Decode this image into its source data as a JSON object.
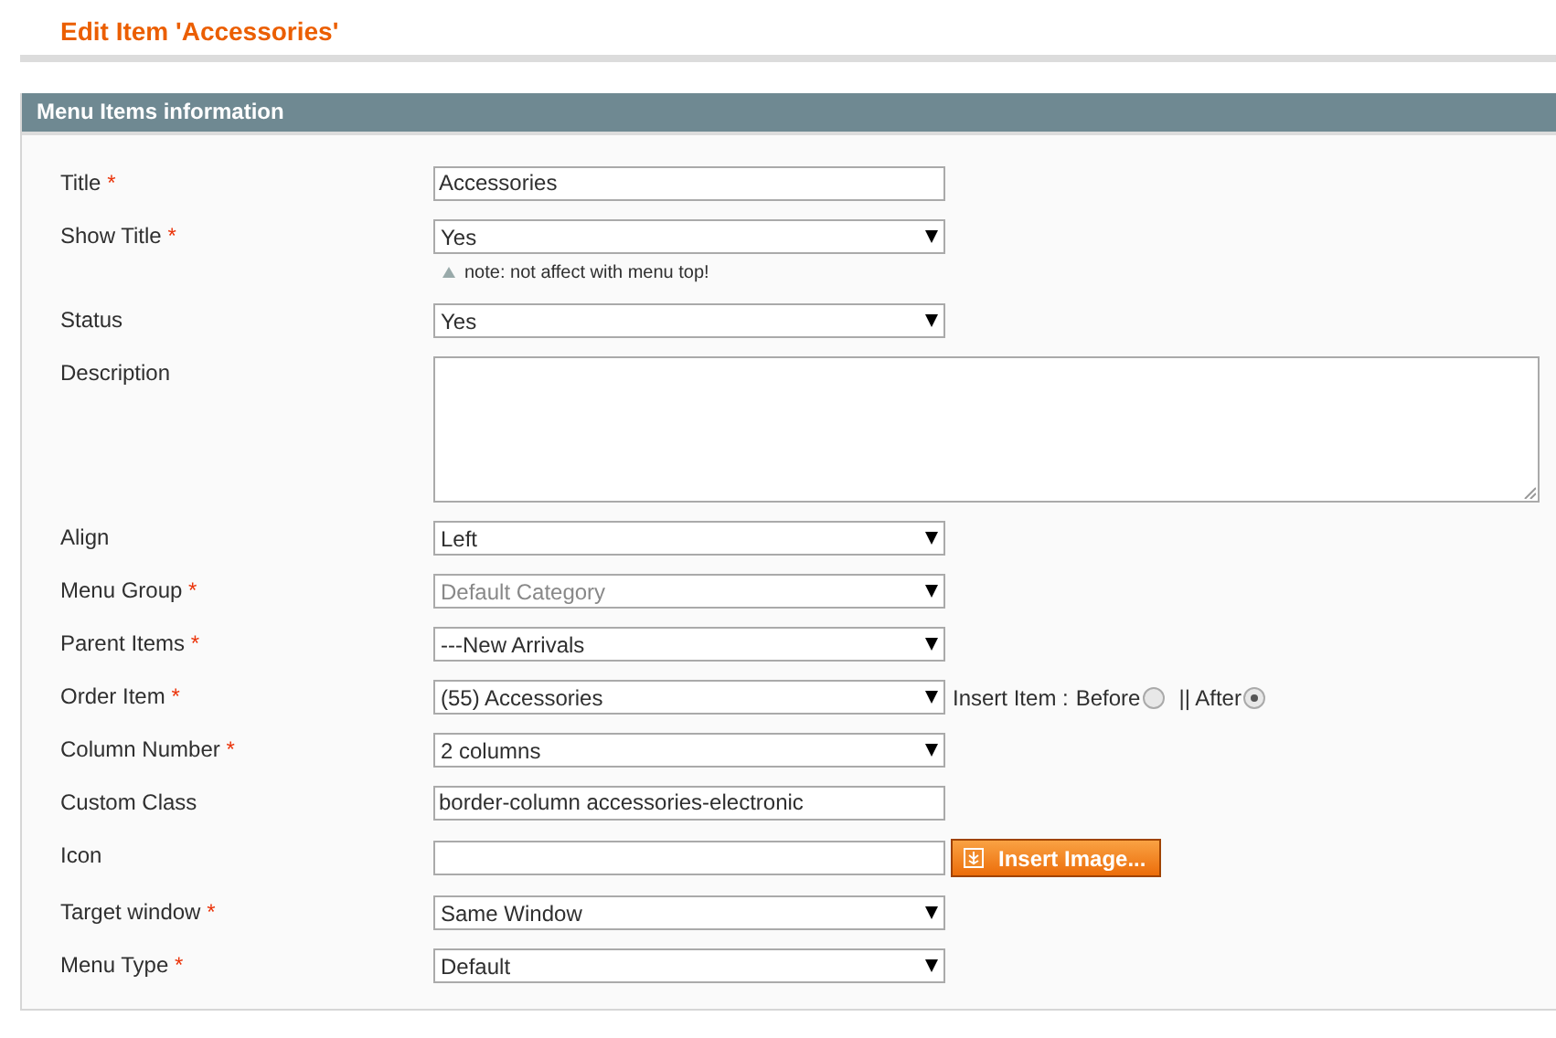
{
  "page_title": "Edit Item 'Accessories'",
  "panel": {
    "title": "Menu Items information",
    "fields": [
      {
        "label": "Title",
        "required_mark": "*",
        "kind": "text",
        "value": "Accessories"
      },
      {
        "label": "Show Title",
        "required_mark": "*",
        "kind": "select",
        "value": "Yes",
        "note": "note: not affect with menu top!"
      },
      {
        "label": "Status",
        "kind": "select",
        "value": "Yes"
      },
      {
        "label": "Description",
        "kind": "textarea"
      },
      {
        "label": "Align",
        "kind": "select",
        "value": "Left"
      },
      {
        "label": "Menu Group",
        "required_mark": "*",
        "kind": "select",
        "value": "Default Category",
        "disabled": true
      },
      {
        "label": "Parent Items",
        "required_mark": "*",
        "kind": "select",
        "value": "---New Arrivals"
      },
      {
        "label": "Order Item",
        "required_mark": "*",
        "kind": "select",
        "value": "(55) Accessories",
        "insert": {
          "label": "Insert Item :",
          "options": [
            {
              "label": "Before",
              "selected": false
            },
            {
              "label": "|| After",
              "selected": true
            }
          ]
        }
      },
      {
        "label": "Column Number",
        "required_mark": "*",
        "kind": "select",
        "value": "2 columns"
      },
      {
        "label": "Custom Class",
        "kind": "text",
        "value": "border-column accessories-electronic"
      },
      {
        "label": "Icon",
        "kind": "text",
        "button": "Insert Image..."
      },
      {
        "label": "Target window",
        "required_mark": "*",
        "kind": "select",
        "value": "Same Window"
      },
      {
        "label": "Menu Type",
        "required_mark": "*",
        "kind": "select",
        "value": "Default"
      }
    ]
  }
}
